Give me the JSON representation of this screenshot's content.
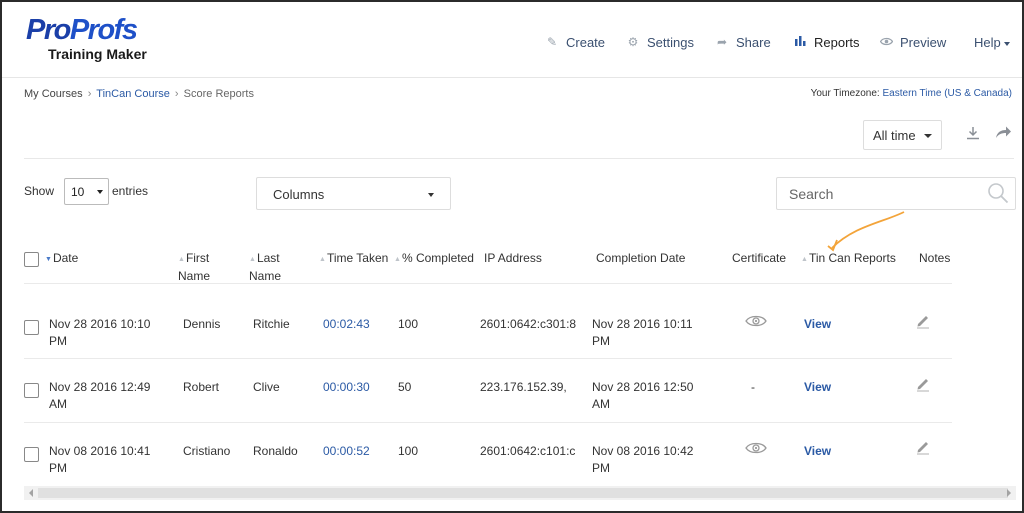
{
  "brand": {
    "logo_top_left": "Pro",
    "logo_top_right": "Profs",
    "logo_sub": "Training Maker",
    "primary": "#1b3fa8",
    "link": "#2b5aa5",
    "accent_arrow": "#f3a43a"
  },
  "nav": [
    {
      "label": "Create",
      "icon": "pencil-icon"
    },
    {
      "label": "Settings",
      "icon": "gear-icon"
    },
    {
      "label": "Share",
      "icon": "share-icon"
    },
    {
      "label": "Reports",
      "icon": "bar-chart-icon",
      "active": true
    },
    {
      "label": "Preview",
      "icon": "eye-icon"
    },
    {
      "label": "Help",
      "icon": "caret-down-icon"
    }
  ],
  "breadcrumb": {
    "root": "My Courses",
    "course": "TinCan Course",
    "current": "Score Reports",
    "separator": "›"
  },
  "timezone": {
    "label": "Your Timezone:",
    "value": "Eastern Time (US & Canada)"
  },
  "time_filter": "All time",
  "controls": {
    "show_label": "Show",
    "entries_value": "10",
    "entries_label": "entries",
    "columns_label": "Columns",
    "search_placeholder": "Search"
  },
  "table": {
    "columns": [
      "Date",
      "First Name",
      "Last Name",
      "Time Taken",
      "% Completed",
      "IP Address",
      "Completion Date",
      "Certificate",
      "Tin Can Reports",
      "Notes"
    ],
    "rows": [
      {
        "date": "Nov 28 2016 10:10",
        "date_ampm": "PM",
        "first": "Dennis",
        "last": "Ritchie",
        "time": "00:02:43",
        "pct": "100",
        "ip": "2601:0642:c301:8",
        "comp": "Nov 28 2016 10:11",
        "comp_ampm": "PM",
        "cert": "eye",
        "cert_text": "",
        "tincan": "View"
      },
      {
        "date": "Nov 28 2016 12:49",
        "date_ampm": "AM",
        "first": "Robert",
        "last": "Clive",
        "time": "00:00:30",
        "pct": "50",
        "ip": "223.176.152.39,",
        "comp": "Nov 28 2016 12:50",
        "comp_ampm": "AM",
        "cert": "none",
        "cert_text": "-",
        "tincan": "View"
      },
      {
        "date": "Nov 08 2016 10:41",
        "date_ampm": "PM",
        "first": "Cristiano",
        "last": "Ronaldo",
        "time": "00:00:52",
        "pct": "100",
        "ip": "2601:0642:c101:c",
        "comp": "Nov 08 2016 10:42",
        "comp_ampm": "PM",
        "cert": "eye",
        "cert_text": "",
        "tincan": "View"
      }
    ]
  }
}
